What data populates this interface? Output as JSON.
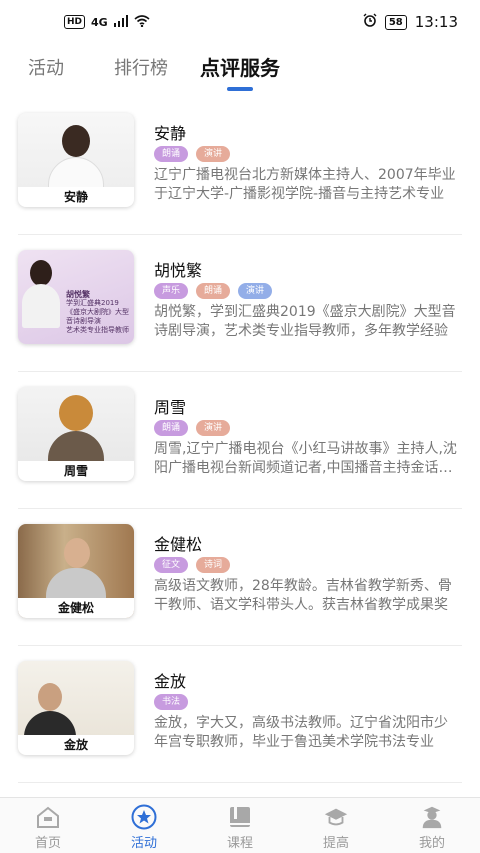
{
  "status_bar": {
    "network": "4G",
    "hd": "HD",
    "battery": "58",
    "time": "13:13"
  },
  "tabs": [
    {
      "label": "活动"
    },
    {
      "label": "排行榜"
    },
    {
      "label": "点评服务"
    }
  ],
  "active_tab": "点评服务",
  "colors": {
    "accent": "#2f6fd6",
    "tag_purple": "#c79bdf",
    "tag_salmon": "#e6ab9a",
    "tag_blue": "#93aee8"
  },
  "teachers": [
    {
      "name": "安静",
      "thumb_caption": "安静",
      "tags": [
        {
          "label": "朗诵",
          "color": "purple"
        },
        {
          "label": "演讲",
          "color": "salmon"
        }
      ],
      "description": "辽宁广播电视台北方新媒体主持人、2007年毕业于辽宁大学-广播影视学院-播音与主持艺术专业"
    },
    {
      "name": "胡悦繁",
      "thumb_caption": "",
      "thumb_poster": [
        "胡悦繁",
        "学到汇盛典2019",
        "《盛京大剧院》大型音诗剧导演",
        "艺术类专业指导教师"
      ],
      "tags": [
        {
          "label": "声乐",
          "color": "purple"
        },
        {
          "label": "朗诵",
          "color": "salmon"
        },
        {
          "label": "演讲",
          "color": "blue"
        }
      ],
      "description": "胡悦繁，学到汇盛典2019《盛京大剧院》大型音诗剧导演，艺术类专业指导教师，多年教学经验"
    },
    {
      "name": "周雪",
      "thumb_caption": "周雪",
      "tags": [
        {
          "label": "朗诵",
          "color": "purple"
        },
        {
          "label": "演讲",
          "color": "salmon"
        }
      ],
      "description": "周雪,辽宁广播电视台《小红马讲故事》主持人,沈阳广播电视台新闻频道记者,中国播音主持金话筒奖"
    },
    {
      "name": "金健松",
      "thumb_caption": "金健松",
      "tags": [
        {
          "label": "征文",
          "color": "purple"
        },
        {
          "label": "诗词",
          "color": "salmon"
        }
      ],
      "description": "高级语文教师，28年教龄。吉林省教学新秀、骨干教师、语文学科带头人。获吉林省教学成果奖"
    },
    {
      "name": "金放",
      "thumb_caption": "金放",
      "tags": [
        {
          "label": "书法",
          "color": "purple"
        }
      ],
      "description": "金放，字大又，高级书法教师。辽宁省沈阳市少年宫专职教师，毕业于鲁迅美术学院书法专业"
    }
  ],
  "bottom_nav": [
    {
      "label": "首页",
      "icon": "home-icon"
    },
    {
      "label": "活动",
      "icon": "star-icon"
    },
    {
      "label": "课程",
      "icon": "book-icon"
    },
    {
      "label": "提高",
      "icon": "graduation-cap-icon"
    },
    {
      "label": "我的",
      "icon": "user-icon"
    }
  ],
  "active_nav": "活动"
}
